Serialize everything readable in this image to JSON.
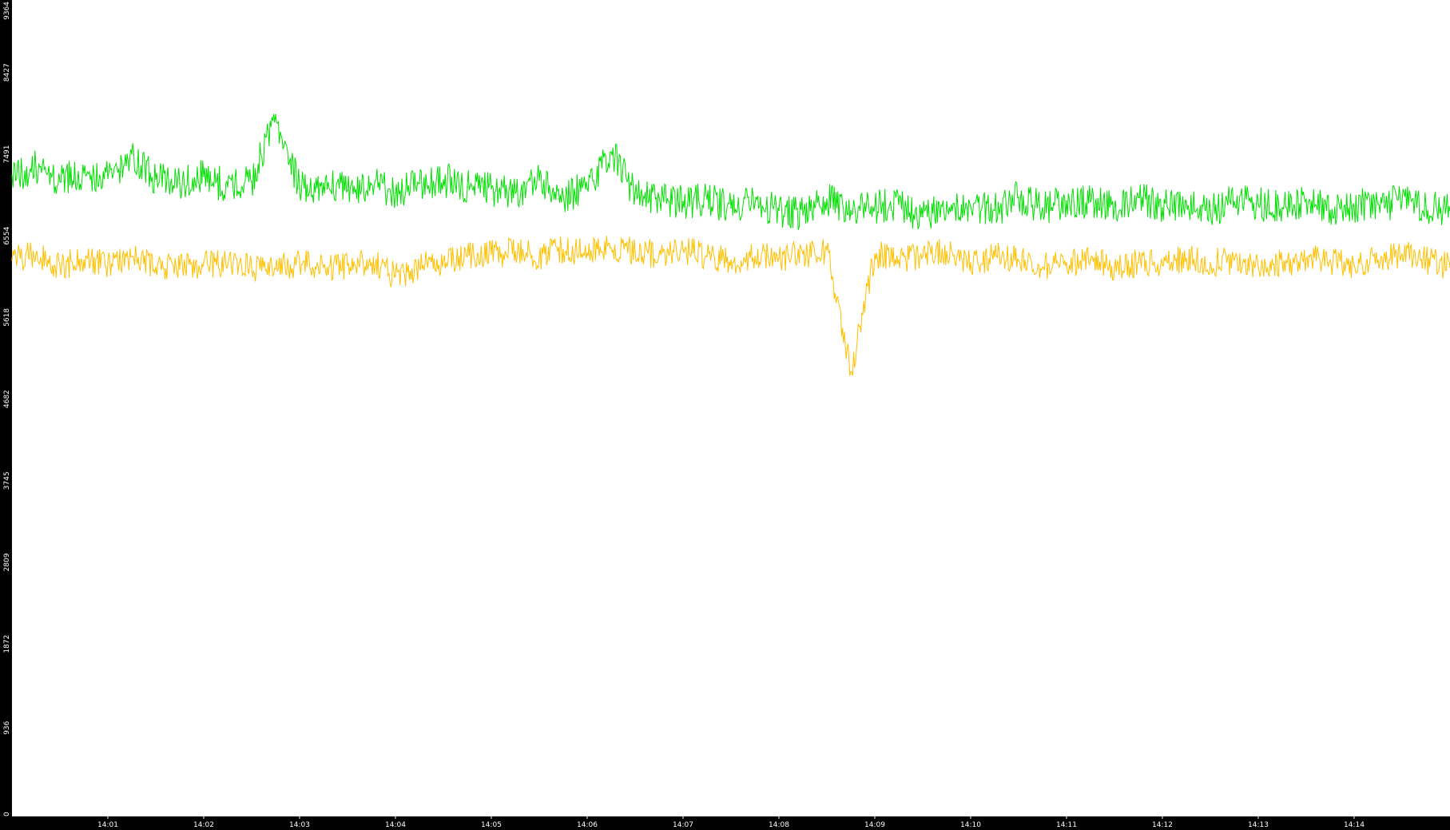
{
  "chart_data": {
    "type": "line",
    "title": "",
    "xlabel": "",
    "ylabel": "",
    "ylim": [
      0,
      9364
    ],
    "xlim": [
      "14:00:00",
      "14:15:00"
    ],
    "yticks": [
      "0",
      "936",
      "1872",
      "2809",
      "3745",
      "4682",
      "5618",
      "6554",
      "7491",
      "8427",
      "9364"
    ],
    "xticks": [
      "14:01",
      "14:02",
      "14:03",
      "14:04",
      "14:05",
      "14:06",
      "14:07",
      "14:08",
      "14:09",
      "14:10",
      "14:11",
      "14:12",
      "14:13",
      "14:14"
    ],
    "grid": false,
    "legend": "none",
    "colors": {
      "background": "#ffffff",
      "frame": "#000000",
      "text": "#ffffff"
    },
    "series": [
      {
        "color": "#00e000",
        "x": [
          "14:00:00",
          "14:00:15",
          "14:00:30",
          "14:00:45",
          "14:01:00",
          "14:01:15",
          "14:01:30",
          "14:01:45",
          "14:02:00",
          "14:02:15",
          "14:02:30",
          "14:02:45",
          "14:03:00",
          "14:03:15",
          "14:03:30",
          "14:03:45",
          "14:04:00",
          "14:04:15",
          "14:04:30",
          "14:04:45",
          "14:05:00",
          "14:05:15",
          "14:05:30",
          "14:05:45",
          "14:06:00",
          "14:06:15",
          "14:06:30",
          "14:06:45",
          "14:07:00",
          "14:07:15",
          "14:07:30",
          "14:07:45",
          "14:08:00",
          "14:08:15",
          "14:08:30",
          "14:08:45",
          "14:09:00",
          "14:09:15",
          "14:09:30",
          "14:09:45",
          "14:10:00",
          "14:10:15",
          "14:10:30",
          "14:10:45",
          "14:11:00",
          "14:11:15",
          "14:11:30",
          "14:11:45",
          "14:12:00",
          "14:12:15",
          "14:12:30",
          "14:12:45",
          "14:13:00",
          "14:13:15",
          "14:13:30",
          "14:13:45",
          "14:14:00",
          "14:14:15",
          "14:14:30",
          "14:14:45",
          "14:15:00"
        ],
        "values": [
          7350,
          7450,
          7280,
          7380,
          7320,
          7600,
          7310,
          7260,
          7340,
          7220,
          7280,
          8050,
          7200,
          7260,
          7180,
          7250,
          7150,
          7260,
          7300,
          7220,
          7200,
          7150,
          7300,
          7120,
          7200,
          7620,
          7150,
          7100,
          7050,
          7080,
          6980,
          7020,
          6950,
          6900,
          7080,
          6950,
          7000,
          7020,
          6880,
          7050,
          7000,
          6950,
          7100,
          6980,
          7060,
          7050,
          7000,
          7100,
          6980,
          7050,
          6950,
          7050,
          7020,
          6980,
          7080,
          6950,
          7000,
          7020,
          7050,
          7000,
          6950
        ]
      },
      {
        "color": "#ffc000",
        "x": [
          "14:00:00",
          "14:00:15",
          "14:00:30",
          "14:00:45",
          "14:01:00",
          "14:01:15",
          "14:01:30",
          "14:01:45",
          "14:02:00",
          "14:02:15",
          "14:02:30",
          "14:02:45",
          "14:03:00",
          "14:03:15",
          "14:03:30",
          "14:03:45",
          "14:04:00",
          "14:04:15",
          "14:04:30",
          "14:04:45",
          "14:05:00",
          "14:05:15",
          "14:05:30",
          "14:05:45",
          "14:06:00",
          "14:06:15",
          "14:06:30",
          "14:06:45",
          "14:07:00",
          "14:07:15",
          "14:07:30",
          "14:07:45",
          "14:08:00",
          "14:08:15",
          "14:08:30",
          "14:08:45",
          "14:09:00",
          "14:09:15",
          "14:09:30",
          "14:09:45",
          "14:10:00",
          "14:10:15",
          "14:10:30",
          "14:10:45",
          "14:11:00",
          "14:11:15",
          "14:11:30",
          "14:11:45",
          "14:12:00",
          "14:12:15",
          "14:12:30",
          "14:12:45",
          "14:13:00",
          "14:13:15",
          "14:13:30",
          "14:13:45",
          "14:14:00",
          "14:14:15",
          "14:14:30",
          "14:14:45",
          "14:15:00"
        ],
        "values": [
          6380,
          6450,
          6320,
          6380,
          6350,
          6420,
          6300,
          6280,
          6350,
          6320,
          6300,
          6280,
          6360,
          6300,
          6320,
          6350,
          6200,
          6300,
          6380,
          6420,
          6450,
          6480,
          6420,
          6500,
          6460,
          6520,
          6480,
          6450,
          6500,
          6420,
          6380,
          6420,
          6400,
          6450,
          6500,
          5100,
          6450,
          6380,
          6420,
          6480,
          6350,
          6420,
          6380,
          6300,
          6350,
          6380,
          6300,
          6350,
          6320,
          6400,
          6350,
          6380,
          6300,
          6350,
          6400,
          6380,
          6320,
          6380,
          6450,
          6380,
          6300
        ]
      }
    ]
  }
}
